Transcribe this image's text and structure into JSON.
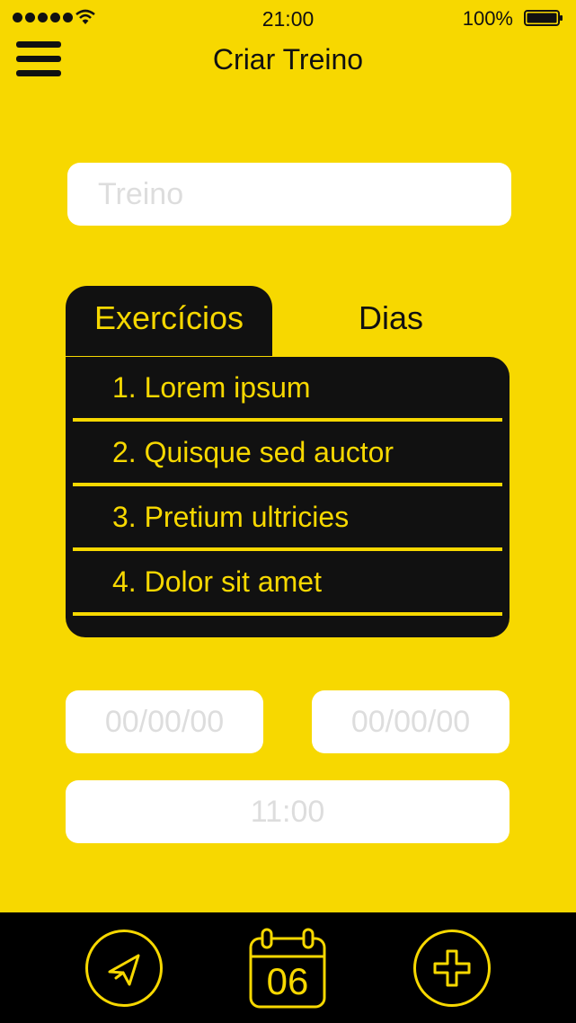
{
  "status_bar": {
    "time": "21:00",
    "battery": "100%"
  },
  "header": {
    "title": "Criar Treino"
  },
  "workout_input": {
    "placeholder": "Treino"
  },
  "tabs": [
    {
      "label": "Exercícios",
      "active": true
    },
    {
      "label": "Dias",
      "active": false
    }
  ],
  "exercises": [
    {
      "label": "1. Lorem ipsum"
    },
    {
      "label": "2. Quisque sed auctor"
    },
    {
      "label": "3. Pretium ultricies"
    },
    {
      "label": "4. Dolor sit amet"
    }
  ],
  "dates": {
    "start_placeholder": "00/00/00",
    "end_placeholder": "00/00/00"
  },
  "time_input": {
    "placeholder": "11:00"
  },
  "bottom_bar": {
    "calendar_day": "06",
    "icons": [
      "send-icon",
      "calendar-icon",
      "plus-icon"
    ]
  },
  "colors": {
    "accent": "#F7D800",
    "dark": "#111111",
    "input_bg": "#FFFFFF",
    "placeholder": "#DDDDDD"
  }
}
